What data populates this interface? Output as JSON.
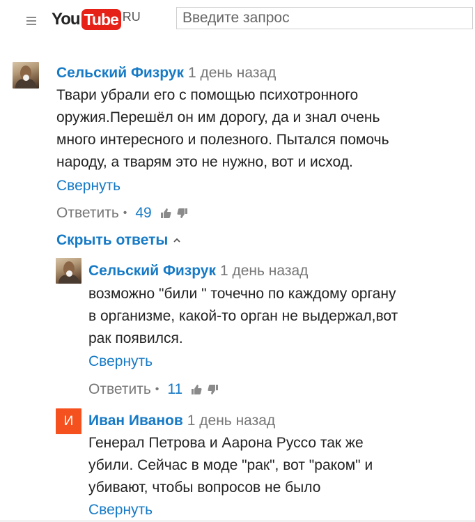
{
  "header": {
    "logo_you": "You",
    "logo_tube": "Tube",
    "logo_region": "RU",
    "search_placeholder": "Введите запрос"
  },
  "comment": {
    "author": "Сельский Физрук",
    "time": "1 день назад",
    "lines": [
      "Твари убрали его с помощью психотронного",
      "оружия.Перешёл он им дорогу, да и знал очень",
      "много интересного и полезного. Пытался помочь",
      "народу, а тварям это не нужно, вот и исход."
    ],
    "collapse_label": "Свернуть",
    "reply_label": "Ответить",
    "likes": "49",
    "hide_replies_label": "Скрыть ответы"
  },
  "replies": [
    {
      "author": "Сельский Физрук",
      "time": "1 день назад",
      "lines": [
        "возможно \"били \" точечно по каждому органу",
        "в организме, какой-то орган не выдержал,вот",
        "рак появился."
      ],
      "collapse_label": "Свернуть",
      "reply_label": "Ответить",
      "likes": "11"
    },
    {
      "author": "Иван Иванов",
      "avatar_letter": "И",
      "time": "1 день назад",
      "lines": [
        "Генерал Петрова и Аарона Руссо так же",
        "убили. Сейчас в моде \"рак\", вот \"раком\" и",
        "убивают, чтобы вопросов не было"
      ],
      "collapse_label": "Свернуть"
    }
  ],
  "colors": {
    "link": "#167ac6",
    "muted": "#767676",
    "brand_red": "#e62117",
    "avatar_orange": "#f4511e"
  }
}
